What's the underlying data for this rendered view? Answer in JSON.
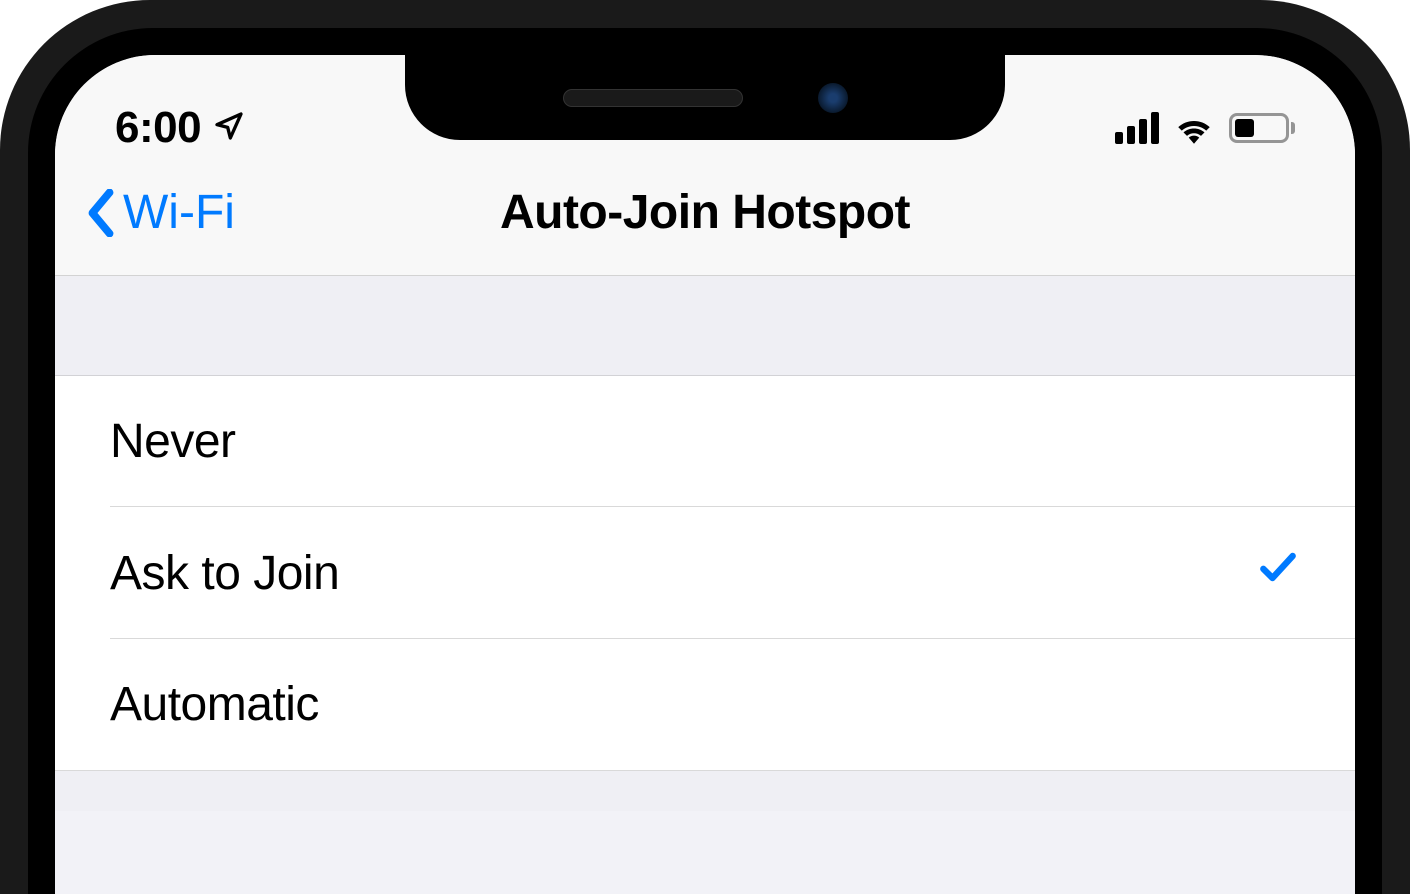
{
  "status_bar": {
    "time": "6:00",
    "location_active": true,
    "cellular_bars": 4,
    "wifi_active": true,
    "battery_percent": 40
  },
  "nav": {
    "back_label": "Wi-Fi",
    "title": "Auto-Join Hotspot"
  },
  "options": [
    {
      "label": "Never",
      "selected": false
    },
    {
      "label": "Ask to Join",
      "selected": true
    },
    {
      "label": "Automatic",
      "selected": false
    }
  ],
  "colors": {
    "accent": "#007AFF",
    "background": "#efeff4",
    "row_background": "#ffffff"
  }
}
